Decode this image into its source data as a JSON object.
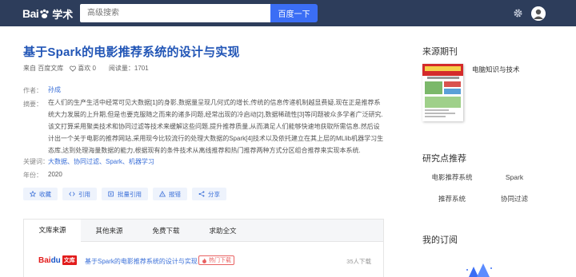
{
  "header": {
    "logo_text": "Bai",
    "logo_suffix": "学术",
    "search_placeholder": "高级搜索",
    "search_button": "百度一下"
  },
  "article": {
    "title": "基于Spark的电影推荐系统的设计与实现",
    "source": "来自 百度文库",
    "likes": "喜欢 0",
    "reads": "阅读量：1701",
    "author_label": "作者：",
    "author": "孙成",
    "abstract_label": "摘要：",
    "abstract": "在人们的生产生活中经常可见大数据[1]的身影,数据量呈现几何式的增长,传统的信息传递机制越显费疑,现在正是推荐系统大力发展的上升期,但是也要克服随之而来的诸多问题,经常出现的冷启动[2],数据稀疏性[3]等问题被众多学者广泛研究.该文打算采用聚类技术和协同过滤等技术来缓解这些问题,提升推荐质量,从而满足人们能够快速地获取所需信息.然后设计出一个关于电影的推荐网站,采用现今比较流行的处理大数据的Spark[4]技术以及依托建立在其上层的MLlib机器学习生态库,达到处理海量数据的能力,根据现有的条件技术从离线推荐和热门推荐两种方式分区组合推荐来实现本系统.",
    "keywords_label": "关键词：",
    "keywords": "大数据、协同过滤、Spark、机器学习",
    "year_label": "年份：",
    "year": "2020"
  },
  "actions": [
    {
      "label": "收藏",
      "icon": "star-icon"
    },
    {
      "label": "引用",
      "icon": "code-icon"
    },
    {
      "label": "批量引用",
      "icon": "batch-icon"
    },
    {
      "label": "报错",
      "icon": "warning-icon"
    },
    {
      "label": "分享",
      "icon": "share-icon"
    }
  ],
  "tabs": [
    "文库来源",
    "其他来源",
    "免费下载",
    "求助全文"
  ],
  "source_row": {
    "logo_a": "Bai",
    "logo_b": "du",
    "logo_c": "文库",
    "link": "基于Spark的电影推荐系统的设计与实现",
    "badge": "热门下载",
    "downloads": "35人下载"
  },
  "sidebar": {
    "journal_heading": "来源期刊",
    "journal_name": "电脑知识与技术",
    "topics_heading": "研究点推荐",
    "topics": [
      "电影推荐系统",
      "Spark",
      "推荐系统",
      "协同过滤"
    ],
    "subscribe_heading": "我的订阅"
  },
  "colors": {
    "header_bg": "#2d3d5b",
    "accent": "#3b6ef5",
    "title": "#2155b6",
    "link": "#3a6fd8"
  }
}
